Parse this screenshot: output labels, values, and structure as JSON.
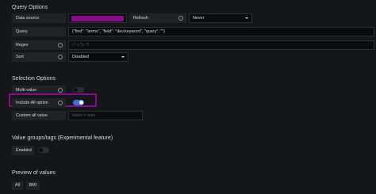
{
  "query_options": {
    "title": "Query Options",
    "datasource_label": "Data source",
    "datasource_color": "#8a0a8a",
    "refresh_label": "Refresh",
    "refresh_value": "Never",
    "query_label": "Query",
    "query_value": "{\"find\": \"terms\", \"field\": \"dev.keyword\", \"query\": \"\"}",
    "regex_label": "Regex",
    "regex_placeholder": "/.*-(.*)-.*/",
    "sort_label": "Sort",
    "sort_value": "Disabled"
  },
  "selection_options": {
    "title": "Selection Options",
    "multi_value_label": "Multi-value",
    "multi_value_on": false,
    "include_all_label": "Include All option",
    "include_all_on": true,
    "highlight_color": "#8a0a8a",
    "custom_all_label": "Custom all value",
    "custom_all_placeholder": "blank = auto"
  },
  "value_groups": {
    "title": "Value groups/tags (Experimental feature)",
    "enabled_label": "Enabled",
    "enabled_on": false
  },
  "preview": {
    "title": "Preview of values",
    "values": [
      "All",
      "BMI"
    ]
  }
}
